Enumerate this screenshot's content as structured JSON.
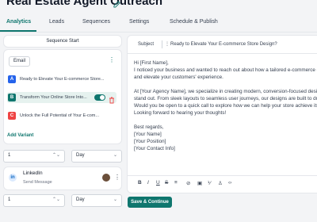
{
  "header": {
    "title": "Real Estate Agent Outreach"
  },
  "tabs": [
    {
      "label": "Analytics"
    },
    {
      "label": "Leads"
    },
    {
      "label": "Sequences"
    },
    {
      "label": "Settings"
    },
    {
      "label": "Schedule & Publish"
    }
  ],
  "sequence": {
    "start_label": "Sequence Start",
    "email_badge": "Email",
    "variants": [
      {
        "letter": "A",
        "text": "Ready to Elevate Your E-commerce Store...",
        "color": "#2563eb"
      },
      {
        "letter": "B",
        "text": "Transform Your Online Store Into...",
        "color": "#0f766e"
      },
      {
        "letter": "C",
        "text": "Unlock the Full Potential of Your E-com...",
        "color": "#ef4444"
      }
    ],
    "add_variant": "Add Variant"
  },
  "delay1": {
    "amount": "1",
    "unit": "Day"
  },
  "linkedin": {
    "title": "LinkedIn",
    "subtitle": "Send Message"
  },
  "delay2": {
    "amount": "1",
    "unit": "Day"
  },
  "editor": {
    "subject_label": "Subject",
    "subject_text": "Ready to Elevate Your E-commerce Store Design?",
    "body": "Hi [First Name],\nI noticed your business and wanted to reach out about how a tailored e-commerce d\nand elevate your customers' experience.\n\nAt [Your Agency Name], we specialize in creating modern, conversion-focused desig\nstand out. From sleek layouts to seamless user journeys, our designs are built to driv\nWould you be open to a quick call to explore how we can help your store achieve its\nLooking forward to hearing your thoughts!\n\nBest regards,\n[Your Name]\n[Your Position]\n[Your Contact Info]"
  },
  "actions": {
    "save_continue": "Save & Continue"
  },
  "colors": {
    "accent": "#0f766e"
  }
}
